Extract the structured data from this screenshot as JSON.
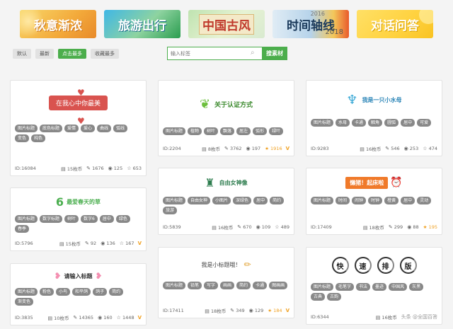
{
  "banners": [
    {
      "label": "秋意渐浓"
    },
    {
      "label": "旅游出行"
    },
    {
      "label": "中国古风"
    },
    {
      "label": "时间轴线",
      "year": "2018",
      "year_small": "2016"
    },
    {
      "label": "对话问答"
    }
  ],
  "filters": [
    {
      "label": "默认",
      "active": false
    },
    {
      "label": "最新",
      "active": false
    },
    {
      "label": "点击最多",
      "active": true
    },
    {
      "label": "收藏最多",
      "active": false
    }
  ],
  "search": {
    "placeholder": "输入标签",
    "button": "搜素材"
  },
  "cards": {
    "c1": {
      "title": "在我心中你最美",
      "tags": [
        "图片标题",
        "底色标题",
        "爱情",
        "爱心",
        "曲线",
        "弧线",
        "变色",
        "纯色"
      ],
      "id": "ID:16084",
      "coins": "15枚币",
      "edits": "1676",
      "views": "125",
      "favs": "653"
    },
    "c2": {
      "title": "关于认证方式",
      "tags": [
        "图片标题",
        "植物",
        "树叶",
        "飘落",
        "居左",
        "弧形",
        "绿叶"
      ],
      "id": "ID:2204",
      "coins": "8枚币",
      "edits": "3762",
      "views": "197",
      "favs": "1916"
    },
    "c3": {
      "title": "我是一只小水母",
      "tags": [
        "图片标题",
        "水母",
        "卡通",
        "触角",
        "圆弧",
        "居中",
        "可爱"
      ],
      "id": "ID:9283",
      "coins": "16枚币",
      "edits": "546",
      "views": "253",
      "favs": "474"
    },
    "c4": {
      "title": "最爱春天的草",
      "tags": [
        "图片标题",
        "数字标题",
        "树叶",
        "数字6",
        "居中",
        "绿色",
        "春季"
      ],
      "id": "ID:5796",
      "coins": "15枚币",
      "edits": "92",
      "views": "136",
      "favs": "167"
    },
    "c5": {
      "title": "自由女神像",
      "tags": [
        "图片标题",
        "自由女神",
        "小图片",
        "深绿色",
        "居中",
        "简约",
        "旅游"
      ],
      "id": "ID:5839",
      "coins": "16枚币",
      "edits": "670",
      "views": "109",
      "favs": "489"
    },
    "c6": {
      "title": "懒猪！起床啦",
      "tags": [
        "图片标题",
        "时间",
        "闹钟",
        "时钟",
        "橙黄",
        "居中",
        "灵动"
      ],
      "id": "ID:17409",
      "coins": "18枚币",
      "edits": "299",
      "views": "88",
      "favs": "195"
    },
    "c7": {
      "title": "请输入标题",
      "tags": [
        "图片标题",
        "粉色",
        "小鸟",
        "和平鸽",
        "鸽子",
        "简约",
        "渐变色"
      ],
      "id": "ID:3835",
      "coins": "10枚币",
      "edits": "14365",
      "views": "160",
      "favs": "1448"
    },
    "c8": {
      "title": "我是小标题哦！",
      "tags": [
        "图片标题",
        "铅笔",
        "写字",
        "画画",
        "简约",
        "卡通",
        "图画画"
      ],
      "id": "ID:17411",
      "coins": "18枚币",
      "edits": "349",
      "views": "129",
      "favs": "184"
    },
    "c9": {
      "chars": [
        "快",
        "速",
        "排",
        "版"
      ],
      "tags": [
        "图片标题",
        "毛笔字",
        "书法",
        "墨迹",
        "中国风",
        "灰黑",
        "古典",
        "古韵"
      ],
      "id": "ID:6344",
      "coins": "16枚币",
      "edits": "",
      "views": "",
      "favs": ""
    }
  },
  "watermark": "头条 @全国百答",
  "colors": {
    "accent": "#4cae4c",
    "red": "#d9534f",
    "orange": "#f0a020"
  }
}
